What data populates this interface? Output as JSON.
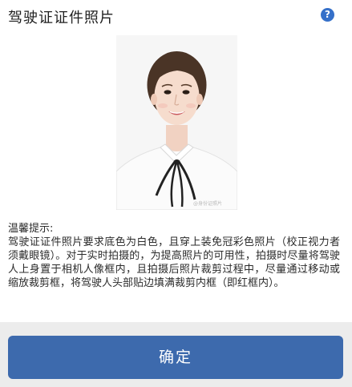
{
  "header": {
    "title": "驾驶证证件照片",
    "help_label": "?"
  },
  "photo": {
    "watermark": "@身份证照片"
  },
  "tips": {
    "heading": "温馨提示:",
    "body": "驾驶证证件照片要求底色为白色，且穿上装免冠彩色照片（校正视力者须戴眼镜）。对于实时拍摄的，为提高照片的可用性，拍摄时尽量将驾驶人上身置于相机人像框内，且拍摄后照片裁剪过程中，尽量通过移动或缩放裁剪框，将驾驶人头部贴边填满裁剪内框（即红框内）。"
  },
  "footer": {
    "confirm_label": "确定"
  },
  "colors": {
    "accent": "#3d6aad",
    "help_icon": "#3570c9",
    "bottom_bar": "#ececec"
  }
}
